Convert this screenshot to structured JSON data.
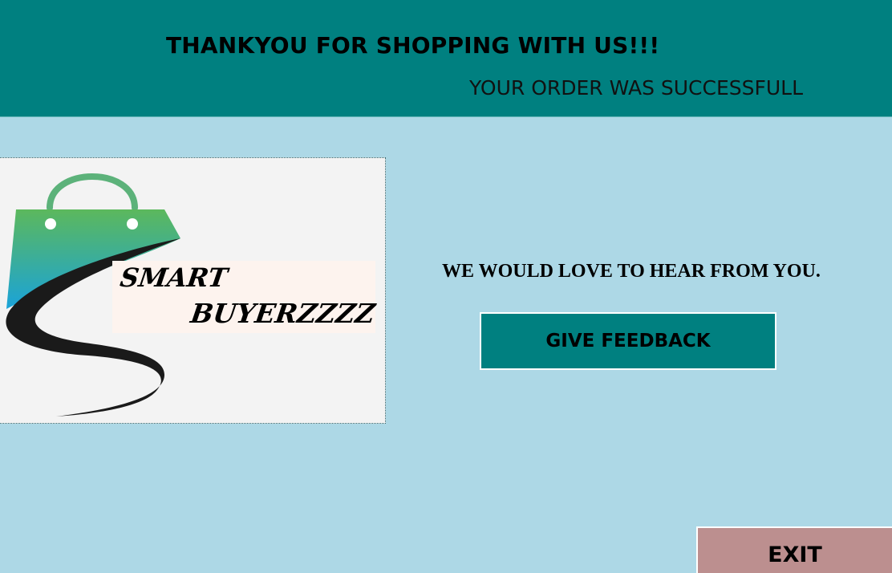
{
  "header": {
    "title": "THANKYOU FOR SHOPPING WITH US!!!",
    "subtitle": "YOUR ORDER WAS SUCCESSFULL"
  },
  "logo": {
    "word_1": "SMART",
    "word_2": "BUYERZZZZ"
  },
  "feedback": {
    "prompt": "WE WOULD LOVE TO HEAR FROM YOU.",
    "button_label": "GIVE FEEDBACK"
  },
  "exit": {
    "button_label": "EXIT"
  },
  "colors": {
    "page_background": "#add8e6",
    "header_background": "#008080",
    "feedback_button": "#008080",
    "exit_button": "#bc8f8f",
    "logo_green": "#5cb85c",
    "logo_blue": "#1aa3d9"
  }
}
